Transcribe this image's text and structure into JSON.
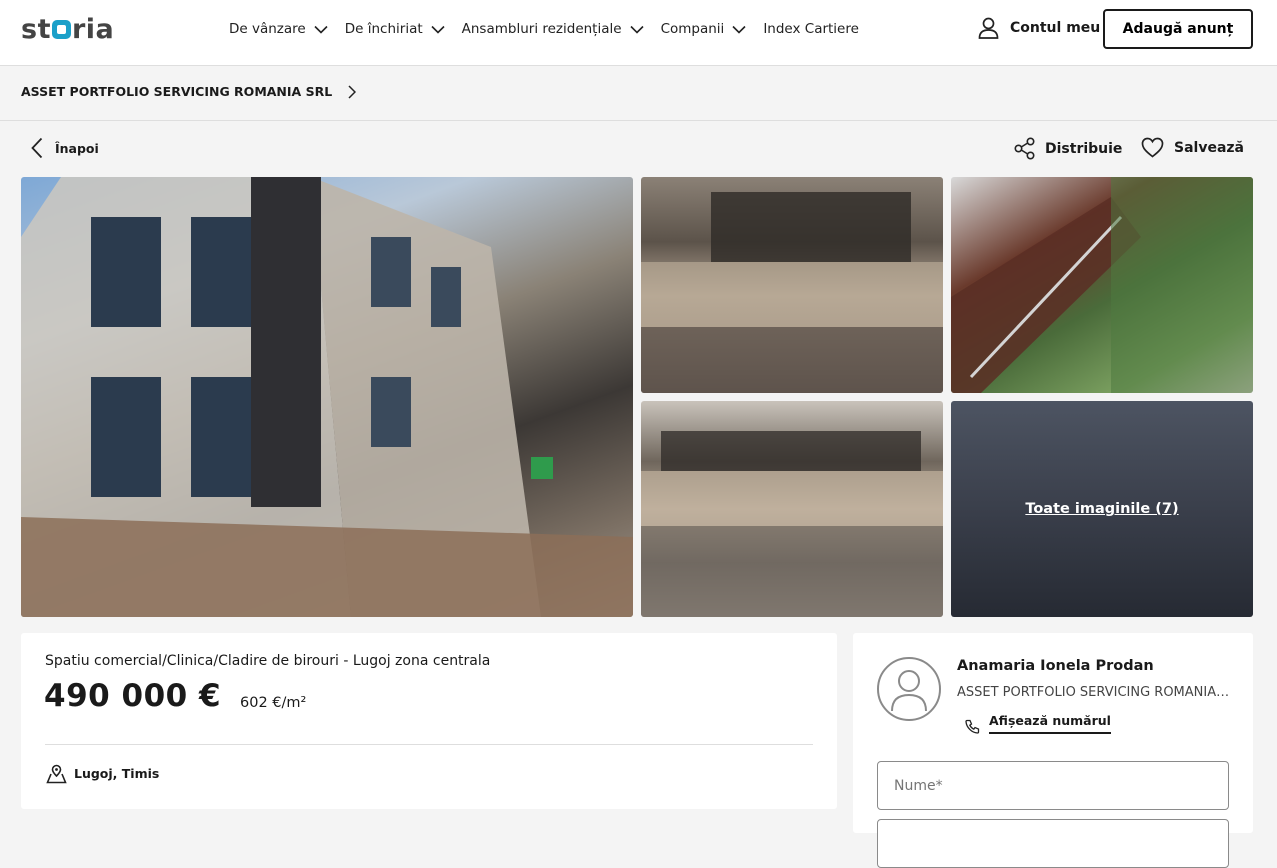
{
  "header": {
    "logo": {
      "prefix": "st",
      "suffix": "ria"
    },
    "nav": [
      {
        "label": "De vânzare",
        "has_dropdown": true
      },
      {
        "label": "De închiriat",
        "has_dropdown": true
      },
      {
        "label": "Ansambluri rezidențiale",
        "has_dropdown": true
      },
      {
        "label": "Companii",
        "has_dropdown": true
      },
      {
        "label": "Index Cartiere",
        "has_dropdown": false
      }
    ],
    "account_label": "Contul meu",
    "add_listing_label": "Adaugă anunț"
  },
  "breadcrumb": {
    "label": "ASSET PORTFOLIO SERVICING ROMANIA SRL"
  },
  "actions": {
    "back_label": "Înapoi",
    "share_label": "Distribuie",
    "save_label": "Salvează"
  },
  "gallery": {
    "all_photos_label": "Toate imaginile (7)",
    "photo_count": 7
  },
  "listing": {
    "title": "Spatiu comercial/Clinica/Cladire de birouri - Lugoj zona centrala",
    "price": "490 000 €",
    "price_per_sqm": "602 €/m²",
    "location": "Lugoj, Timis"
  },
  "agent": {
    "name": "Anamaria Ionela Prodan",
    "company": "ASSET PORTFOLIO SERVICING ROMANIA SRL",
    "show_number_label": "Afișează numărul"
  },
  "contact_form": {
    "name_placeholder": "Nume*",
    "second_placeholder": ""
  }
}
